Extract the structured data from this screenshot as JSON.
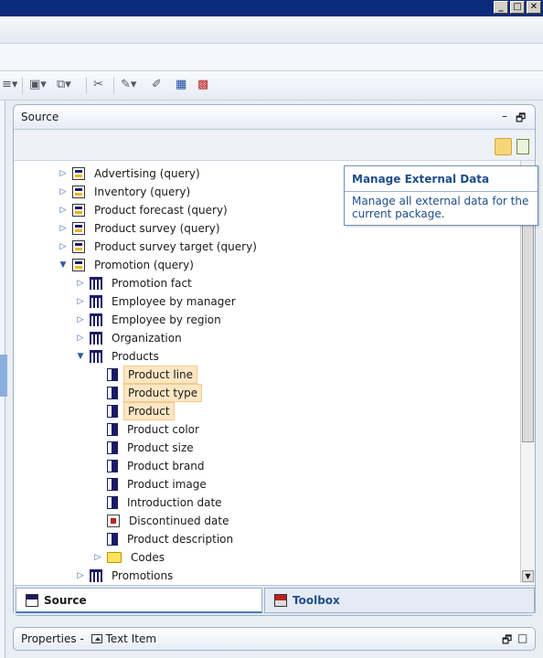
{
  "window": {
    "buttons": [
      "_",
      "□",
      "✕"
    ]
  },
  "source_panel": {
    "title": "Source",
    "minimize": "–",
    "restore": "🗗"
  },
  "tooltip": {
    "title": "Manage External Data",
    "body": "Manage all external data for the current package."
  },
  "tree": {
    "items": [
      {
        "label": "Advertising (query)",
        "icon": "query-subject-icon",
        "expander": "collapsed",
        "level": 0
      },
      {
        "label": "Inventory (query)",
        "icon": "query-subject-icon",
        "expander": "collapsed",
        "level": 0
      },
      {
        "label": "Product forecast (query)",
        "icon": "query-subject-icon",
        "expander": "collapsed",
        "level": 0
      },
      {
        "label": "Product survey (query)",
        "icon": "query-subject-icon",
        "expander": "collapsed",
        "level": 0
      },
      {
        "label": "Product survey target (query)",
        "icon": "query-subject-icon",
        "expander": "collapsed",
        "level": 0
      },
      {
        "label": "Promotion (query)",
        "icon": "query-subject-icon",
        "expander": "expanded",
        "level": 0
      },
      {
        "label": "Promotion fact",
        "icon": "table-icon",
        "expander": "collapsed",
        "level": 1
      },
      {
        "label": "Employee by manager",
        "icon": "table-icon",
        "expander": "collapsed",
        "level": 1
      },
      {
        "label": "Employee by region",
        "icon": "table-icon",
        "expander": "collapsed",
        "level": 1
      },
      {
        "label": "Organization",
        "icon": "table-icon",
        "expander": "collapsed",
        "level": 1
      },
      {
        "label": "Products",
        "icon": "table-icon",
        "expander": "expanded",
        "level": 1
      },
      {
        "label": "Product line",
        "icon": "column-icon",
        "expander": "none",
        "level": 2,
        "selected": true
      },
      {
        "label": "Product type",
        "icon": "column-icon",
        "expander": "none",
        "level": 2,
        "selected": true
      },
      {
        "label": "Product",
        "icon": "column-icon",
        "expander": "none",
        "level": 2,
        "selected": true
      },
      {
        "label": "Product color",
        "icon": "column-icon",
        "expander": "none",
        "level": 2
      },
      {
        "label": "Product size",
        "icon": "column-icon",
        "expander": "none",
        "level": 2
      },
      {
        "label": "Product brand",
        "icon": "column-icon",
        "expander": "none",
        "level": 2
      },
      {
        "label": "Product image",
        "icon": "column-icon",
        "expander": "none",
        "level": 2
      },
      {
        "label": "Introduction date",
        "icon": "column-icon",
        "expander": "none",
        "level": 2
      },
      {
        "label": "Discontinued date",
        "icon": "calculated-column-icon",
        "expander": "none",
        "level": 2
      },
      {
        "label": "Product description",
        "icon": "column-icon",
        "expander": "none",
        "level": 2
      },
      {
        "label": "Codes",
        "icon": "folder-icon",
        "expander": "collapsed",
        "level": 2
      },
      {
        "label": "Promotions",
        "icon": "table-icon",
        "expander": "collapsed",
        "level": 1
      }
    ]
  },
  "tabs": [
    {
      "label": "Source",
      "icon": "source-icon",
      "active": true
    },
    {
      "label": "Toolbox",
      "icon": "toolbox-icon",
      "active": false
    }
  ],
  "properties": {
    "prefix": "Properties - ",
    "item": "Text Item"
  }
}
